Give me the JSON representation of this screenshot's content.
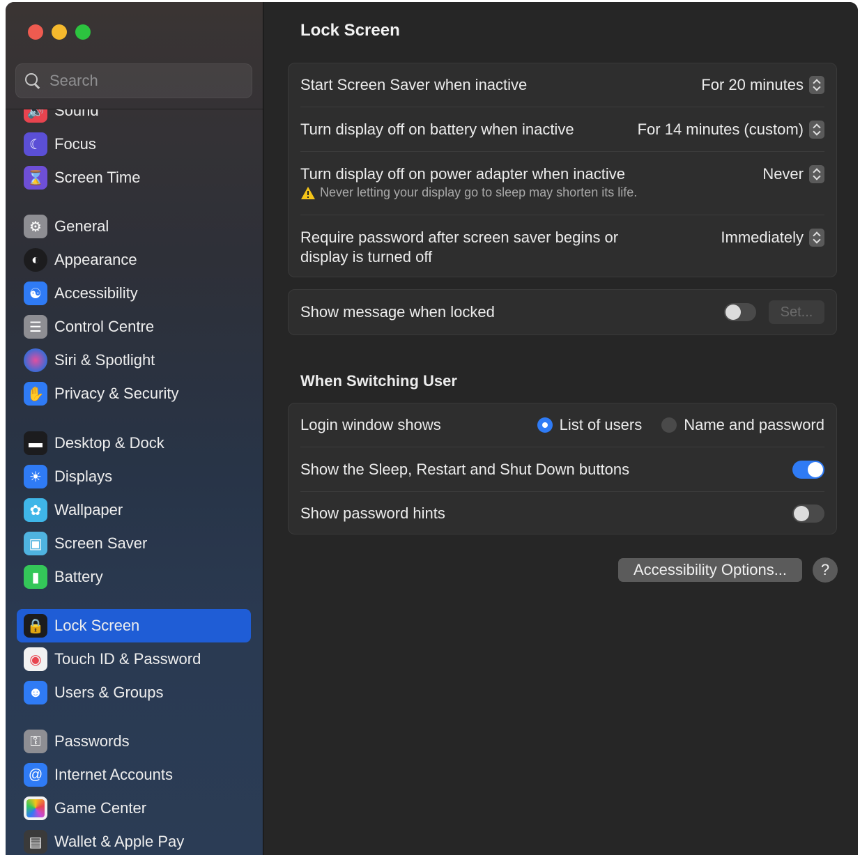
{
  "search": {
    "placeholder": "Search"
  },
  "sidebar": {
    "items": [
      {
        "label": "Sound",
        "icon": "speaker-icon",
        "color": "#e8444f"
      },
      {
        "label": "Focus",
        "icon": "moon-icon",
        "color": "#5b4fd6"
      },
      {
        "label": "Screen Time",
        "icon": "hourglass-icon",
        "color": "#6e4fd6"
      },
      {
        "label": "General",
        "icon": "gear-icon",
        "color": "#8e8e93"
      },
      {
        "label": "Appearance",
        "icon": "appearance-icon",
        "color": "#1c1c1e"
      },
      {
        "label": "Accessibility",
        "icon": "accessibility-icon",
        "color": "#2f7bf5"
      },
      {
        "label": "Control Centre",
        "icon": "control-centre-icon",
        "color": "#8e8e93"
      },
      {
        "label": "Siri & Spotlight",
        "icon": "siri-icon",
        "color": "#c44ad6"
      },
      {
        "label": "Privacy & Security",
        "icon": "hand-icon",
        "color": "#2f7bf5"
      },
      {
        "label": "Desktop & Dock",
        "icon": "dock-icon",
        "color": "#1c1c1e"
      },
      {
        "label": "Displays",
        "icon": "sun-icon",
        "color": "#2f7bf5"
      },
      {
        "label": "Wallpaper",
        "icon": "flower-icon",
        "color": "#3fb6e8"
      },
      {
        "label": "Screen Saver",
        "icon": "screen-saver-icon",
        "color": "#4fb3e0"
      },
      {
        "label": "Battery",
        "icon": "battery-icon",
        "color": "#34c759"
      },
      {
        "label": "Lock Screen",
        "icon": "lock-icon",
        "color": "#1c1c1e"
      },
      {
        "label": "Touch ID & Password",
        "icon": "fingerprint-icon",
        "color": "#f2f2f2"
      },
      {
        "label": "Users & Groups",
        "icon": "users-icon",
        "color": "#2f7bf5"
      },
      {
        "label": "Passwords",
        "icon": "key-icon",
        "color": "#8e8e93"
      },
      {
        "label": "Internet Accounts",
        "icon": "at-icon",
        "color": "#2f7bf5"
      },
      {
        "label": "Game Center",
        "icon": "game-center-icon",
        "color": "#f2f2f2"
      },
      {
        "label": "Wallet & Apple Pay",
        "icon": "wallet-icon",
        "color": "#3a3a3a"
      }
    ]
  },
  "main": {
    "title": "Lock Screen",
    "screen_saver": {
      "label": "Start Screen Saver when inactive",
      "value": "For 20 minutes"
    },
    "display_battery": {
      "label": "Turn display off on battery when inactive",
      "value": "For 14 minutes (custom)"
    },
    "display_power": {
      "label": "Turn display off on power adapter when inactive",
      "value": "Never",
      "warning": "Never letting your display go to sleep may shorten its life."
    },
    "require_password": {
      "label_line1": "Require password after screen saver begins or",
      "label_line2": "display is turned off",
      "value": "Immediately"
    },
    "show_message": {
      "label": "Show message when locked",
      "toggle_on": false,
      "set_button": "Set..."
    },
    "switching_section": "When Switching User",
    "login_window": {
      "label": "Login window shows",
      "option1": "List of users",
      "option2": "Name and password",
      "selected": "List of users"
    },
    "sleep_buttons": {
      "label": "Show the Sleep, Restart and Shut Down buttons",
      "toggle_on": true
    },
    "password_hints": {
      "label": "Show password hints",
      "toggle_on": false
    },
    "accessibility_button": "Accessibility Options...",
    "help_button": "?"
  },
  "colors": {
    "accent": "#2f7bf5",
    "selected_sidebar": "#1f5dd6",
    "warning": "#f5c518"
  }
}
